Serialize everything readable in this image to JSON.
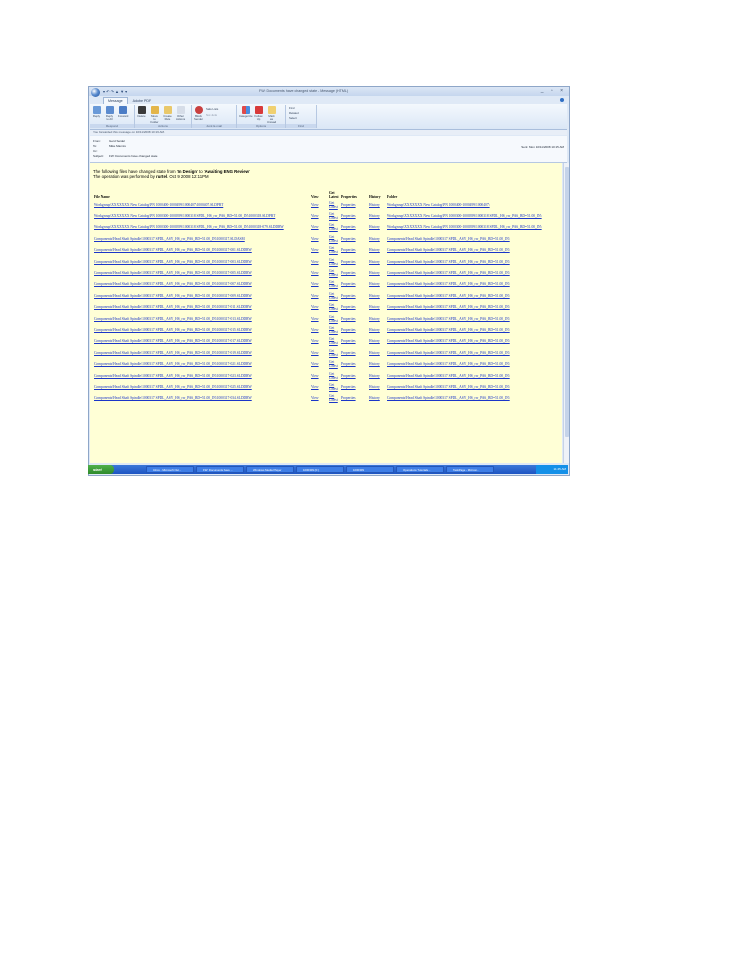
{
  "window": {
    "title": "FW: Documents have changed state - Message (HTML)",
    "controls": "_ ▫ ×"
  },
  "ribbon": {
    "tabs": [
      "Message",
      "Adobe PDF"
    ],
    "groups": [
      {
        "label": "Respond",
        "buttons": [
          "Reply",
          "Reply to All",
          "Forward"
        ]
      },
      {
        "label": "Actions",
        "buttons": [
          "Delete",
          "Move to Folder",
          "Create Rule",
          "Other Actions"
        ]
      },
      {
        "label": "Junk E-mail",
        "buttons": [
          "Block Sender",
          "Safe Lists",
          "Not Junk"
        ]
      },
      {
        "label": "Options",
        "buttons": [
          "Categorize",
          "Follow Up",
          "Mark as Unread"
        ]
      },
      {
        "label": "Find",
        "buttons": [
          "Find",
          "Related",
          "Select"
        ]
      }
    ]
  },
  "infobar": "You forwarded this message on 10/11/2008 10:16 AM.",
  "headers": {
    "from_label": "From:",
    "from": "Gerd Seidel",
    "to_label": "To:",
    "to": "Mike Mannis",
    "cc_label": "Cc:",
    "cc": "",
    "subject_label": "Subject:",
    "subject": "FW: Documents have changed state",
    "sent": "Sent:  Mon 10/11/2008 10:15 AM"
  },
  "message": {
    "line1_prefix": "The following files have changed state from '",
    "from_state": "In Design",
    "line1_mid": "' to '",
    "to_state": "Awaiting ENG Review",
    "line1_suffix": "'",
    "line2_prefix": "The operation was performed by ",
    "user": "rurtel",
    "line2_suffix": ". Oct 9 2008 12:11PM"
  },
  "table": {
    "columns": [
      "File Name",
      "View",
      "Get Latest",
      "Properties",
      "History",
      "Folder"
    ],
    "rows": [
      {
        "file": "Workgroup\\XXXXXXX New Catalog\\PN 1000400-1000499\\1000407\\1000407.SLDPRT",
        "view": "View",
        "get": "Get Latest",
        "props": "Properties",
        "hist": "History",
        "folder": "Workgroup\\XXXXXXX New Catalog\\PN 1000400-1000499\\1000407\\"
      },
      {
        "file": "Workgroup\\XXXXXXX New Catalog\\PN 1000300-1000399\\1000318 SPDL_HS_rw_PA6_BD=51.00_IN\\1000318.SLDPRT",
        "view": "View",
        "get": "Get Latest",
        "props": "Properties",
        "hist": "History",
        "folder": "Workgroup\\XXXXXXX New Catalog\\PN 1000300-1000399\\1000318 SPDL_HS_rw_PA6_BD=51.00_IN\\"
      },
      {
        "file": "Workgroup\\XXXXXXX New Catalog\\PN 1000300-1000399\\1000318 SPDL_HS_rw_PA6_BD=51.00_IN\\1000318-079.SLDDRW",
        "view": "View",
        "get": "Get Latest",
        "props": "Properties",
        "hist": "History",
        "folder": "Workgroup\\XXXXXXX New Catalog\\PN 1000300-1000399\\1000318 SPDL_HS_rw_PA6_BD=51.00_IN\\"
      },
      {
        "file": "Components\\Head Shaft Spindle\\1000317 SPDL_ASY_HS_rw_PA6_BD=51.00_IN\\1000317.SLDASM",
        "view": "View",
        "get": "Get Latest",
        "props": "Properties",
        "hist": "History",
        "folder": "Components\\Head Shaft Spindle\\1000317 SPDL_ASY_HS_rw_PA6_BD=51.00_IN\\"
      },
      {
        "file": "Components\\Head Shaft Spindle\\1000317 SPDL_ASY_HS_rw_PA6_BD=51.00_IN\\1000317-001.SLDDRW",
        "view": "View",
        "get": "Get Latest",
        "props": "Properties",
        "hist": "History",
        "folder": "Components\\Head Shaft Spindle\\1000317 SPDL_ASY_HS_rw_PA6_BD=51.00_IN\\"
      },
      {
        "file": "Components\\Head Shaft Spindle\\1000317 SPDL_ASY_HS_rw_PA6_BD=51.00_IN\\1000317-003.SLDDRW",
        "view": "View",
        "get": "Get Latest",
        "props": "Properties",
        "hist": "History",
        "folder": "Components\\Head Shaft Spindle\\1000317 SPDL_ASY_HS_rw_PA6_BD=51.00_IN\\"
      },
      {
        "file": "Components\\Head Shaft Spindle\\1000317 SPDL_ASY_HS_rw_PA6_BD=51.00_IN\\1000317-005.SLDDRW",
        "view": "View",
        "get": "Get Latest",
        "props": "Properties",
        "hist": "History",
        "folder": "Components\\Head Shaft Spindle\\1000317 SPDL_ASY_HS_rw_PA6_BD=51.00_IN\\"
      },
      {
        "file": "Components\\Head Shaft Spindle\\1000317 SPDL_ASY_HS_rw_PA6_BD=51.00_IN\\1000317-007.SLDDRW",
        "view": "View",
        "get": "Get Latest",
        "props": "Properties",
        "hist": "History",
        "folder": "Components\\Head Shaft Spindle\\1000317 SPDL_ASY_HS_rw_PA6_BD=51.00_IN\\"
      },
      {
        "file": "Components\\Head Shaft Spindle\\1000317 SPDL_ASY_HS_rw_PA6_BD=51.00_IN\\1000317-009.SLDDRW",
        "view": "View",
        "get": "Get Latest",
        "props": "Properties",
        "hist": "History",
        "folder": "Components\\Head Shaft Spindle\\1000317 SPDL_ASY_HS_rw_PA6_BD=51.00_IN\\"
      },
      {
        "file": "Components\\Head Shaft Spindle\\1000317 SPDL_ASY_HS_rw_PA6_BD=51.00_IN\\1000317-011.SLDDRW",
        "view": "View",
        "get": "Get Latest",
        "props": "Properties",
        "hist": "History",
        "folder": "Components\\Head Shaft Spindle\\1000317 SPDL_ASY_HS_rw_PA6_BD=51.00_IN\\"
      },
      {
        "file": "Components\\Head Shaft Spindle\\1000317 SPDL_ASY_HS_rw_PA6_BD=51.00_IN\\1000317-013.SLDDRW",
        "view": "View",
        "get": "Get Latest",
        "props": "Properties",
        "hist": "History",
        "folder": "Components\\Head Shaft Spindle\\1000317 SPDL_ASY_HS_rw_PA6_BD=51.00_IN\\"
      },
      {
        "file": "Components\\Head Shaft Spindle\\1000317 SPDL_ASY_HS_rw_PA6_BD=51.00_IN\\1000317-015.SLDDRW",
        "view": "View",
        "get": "Get Latest",
        "props": "Properties",
        "hist": "History",
        "folder": "Components\\Head Shaft Spindle\\1000317 SPDL_ASY_HS_rw_PA6_BD=51.00_IN\\"
      },
      {
        "file": "Components\\Head Shaft Spindle\\1000317 SPDL_ASY_HS_rw_PA6_BD=51.00_IN\\1000317-017.SLDDRW",
        "view": "View",
        "get": "Get Latest",
        "props": "Properties",
        "hist": "History",
        "folder": "Components\\Head Shaft Spindle\\1000317 SPDL_ASY_HS_rw_PA6_BD=51.00_IN\\"
      },
      {
        "file": "Components\\Head Shaft Spindle\\1000317 SPDL_ASY_HS_rw_PA6_BD=51.00_IN\\1000317-019.SLDDRW",
        "view": "View",
        "get": "Get Latest",
        "props": "Properties",
        "hist": "History",
        "folder": "Components\\Head Shaft Spindle\\1000317 SPDL_ASY_HS_rw_PA6_BD=51.00_IN\\"
      },
      {
        "file": "Components\\Head Shaft Spindle\\1000317 SPDL_ASY_HS_rw_PA6_BD=51.00_IN\\1000317-021.SLDDRW",
        "view": "View",
        "get": "Get Latest",
        "props": "Properties",
        "hist": "History",
        "folder": "Components\\Head Shaft Spindle\\1000317 SPDL_ASY_HS_rw_PA6_BD=51.00_IN\\"
      },
      {
        "file": "Components\\Head Shaft Spindle\\1000317 SPDL_ASY_HS_rw_PA6_BD=51.00_IN\\1000317-023.SLDDRW",
        "view": "View",
        "get": "Get Latest",
        "props": "Properties",
        "hist": "History",
        "folder": "Components\\Head Shaft Spindle\\1000317 SPDL_ASY_HS_rw_PA6_BD=51.00_IN\\"
      },
      {
        "file": "Components\\Head Shaft Spindle\\1000317 SPDL_ASY_HS_rw_PA6_BD=51.00_IN\\1000317-025.SLDDRW",
        "view": "View",
        "get": "Get Latest",
        "props": "Properties",
        "hist": "History",
        "folder": "Components\\Head Shaft Spindle\\1000317 SPDL_ASY_HS_rw_PA6_BD=51.00_IN\\"
      },
      {
        "file": "Components\\Head Shaft Spindle\\1000317 SPDL_ASY_HS_rw_PA6_BD=51.00_IN\\1000317-034.SLDDRW",
        "view": "View",
        "get": "Get Latest",
        "props": "Properties",
        "hist": "History",
        "folder": "Components\\Head Shaft Spindle\\1000317 SPDL_ASY_HS_rw_PA6_BD=51.00_IN\\"
      }
    ]
  },
  "taskbar": {
    "start": "start",
    "buttons": [
      "Inbox - Microsoft Out...",
      "FW: Documents have ...",
      "Windows Media Player",
      "1000309 (F:)",
      "1000309",
      "Operations Tutorials...",
      "TaskPage - Microsi..."
    ],
    "clock": "11:45 AM"
  },
  "colors": {
    "link": "#1b36c8",
    "message_bg": "#ffffd6",
    "taskbar": "#1d54c2",
    "start": "#2e8a2b"
  }
}
